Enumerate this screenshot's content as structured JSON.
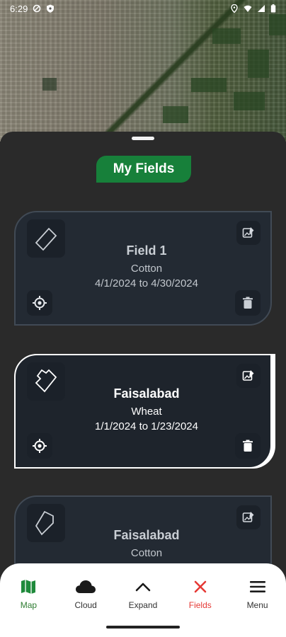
{
  "status_bar": {
    "time": "6:29",
    "left_icons": [
      "data-saver-icon",
      "shield-icon"
    ],
    "right_icons": [
      "location-icon",
      "wifi-icon",
      "signal-icon",
      "battery-icon"
    ]
  },
  "sheet": {
    "title": "My Fields"
  },
  "fields": [
    {
      "name": "Field 1",
      "crop": "Cotton",
      "dates": "4/1/2024 to 4/30/2024",
      "selected": false
    },
    {
      "name": "Faisalabad",
      "crop": "Wheat",
      "dates": "1/1/2024 to 1/23/2024",
      "selected": true
    },
    {
      "name": "Faisalabad",
      "crop": "Cotton",
      "dates": "",
      "selected": false
    }
  ],
  "bottom_nav": {
    "items": [
      {
        "label": "Map",
        "icon": "map-icon"
      },
      {
        "label": "Cloud",
        "icon": "cloud-icon"
      },
      {
        "label": "Expand",
        "icon": "chevron-up-icon"
      },
      {
        "label": "Fields",
        "icon": "close-icon"
      },
      {
        "label": "Menu",
        "icon": "hamburger-menu-icon"
      }
    ]
  },
  "colors": {
    "accent_green": "#17803a",
    "fields_active_red": "#e53935",
    "card_bg": "#232a33"
  }
}
